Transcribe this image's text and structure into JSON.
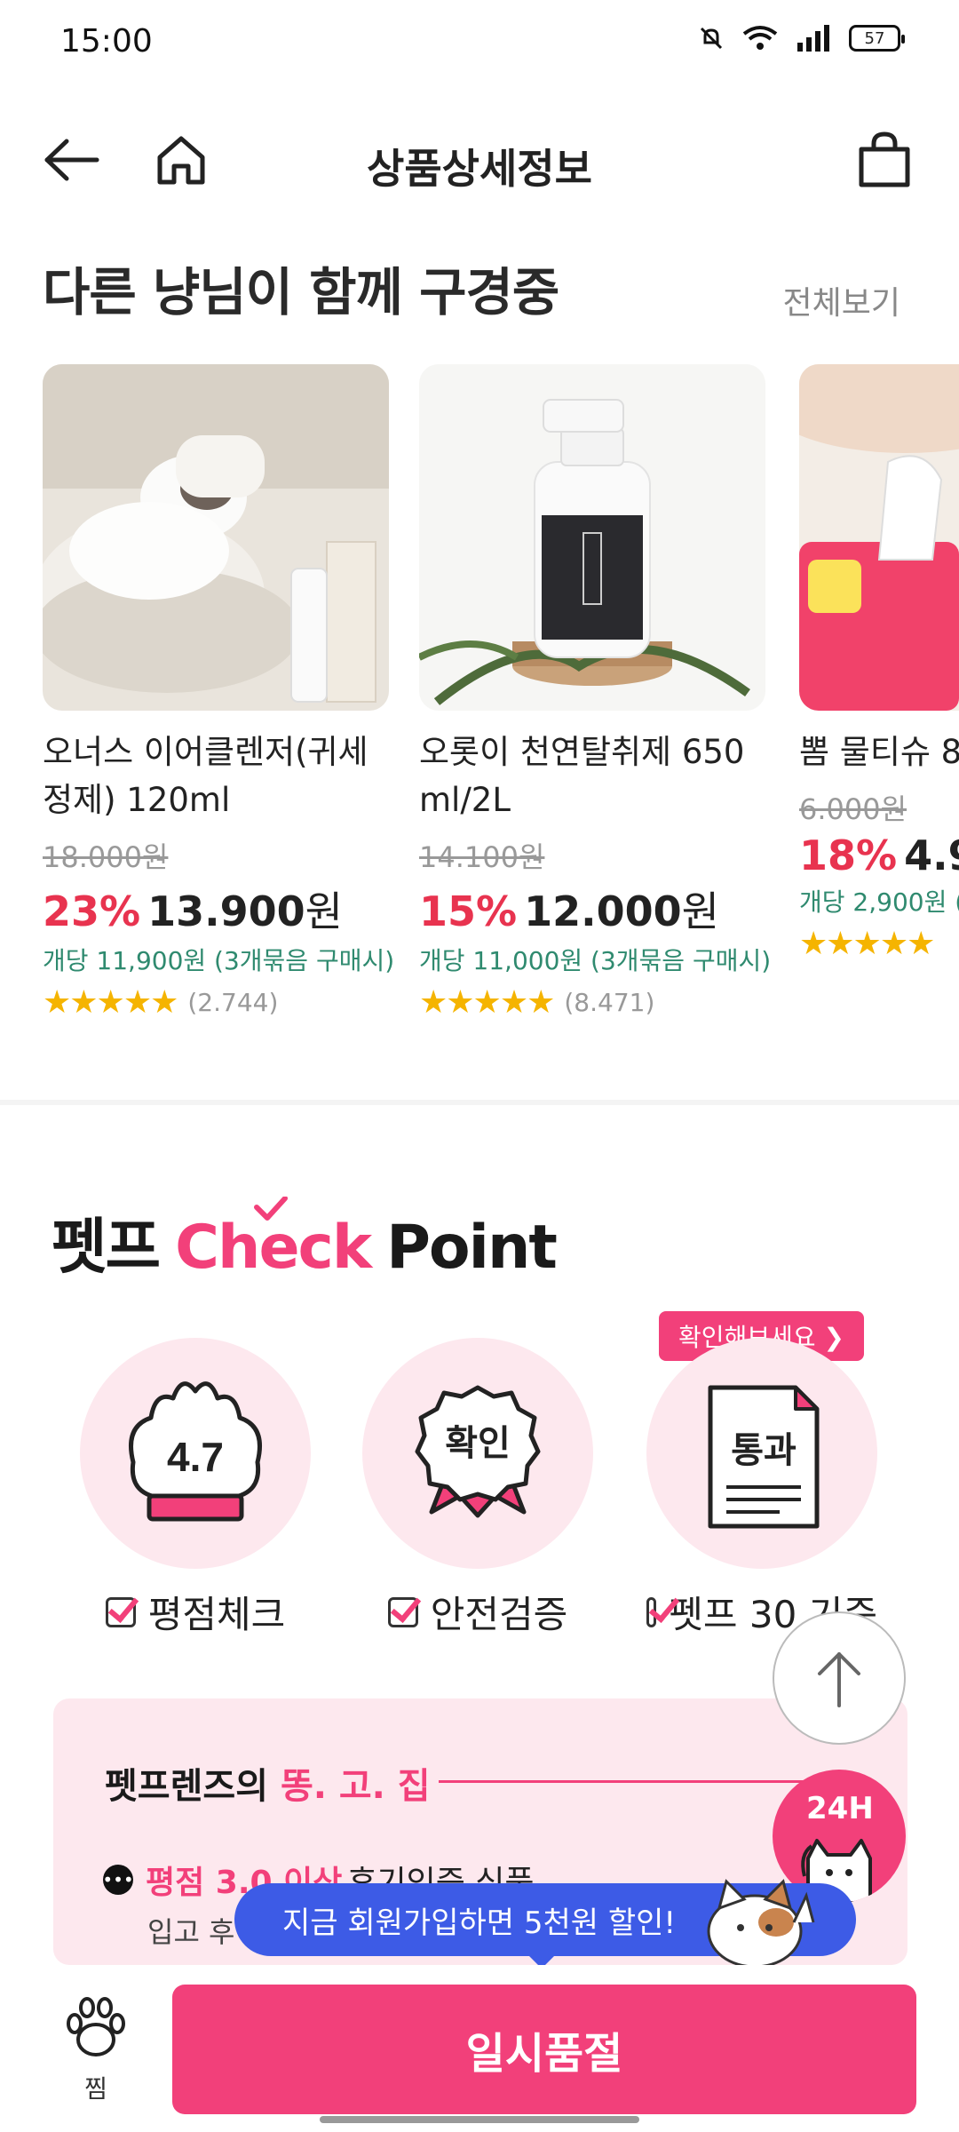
{
  "status_bar": {
    "time": "15:00",
    "battery": "57"
  },
  "header": {
    "title": "상품상세정보"
  },
  "similar": {
    "title": "다른 냥님이 함께 구경중",
    "see_all": "전체보기",
    "products": [
      {
        "name": "오너스 이어클렌저(귀세정제) 120ml",
        "original_price": "18.000원",
        "discount": "23%",
        "price": "13.900",
        "won": "원",
        "unit_price": "개당 11,900원 (3개묶음 구매시)",
        "stars": "★★★★★",
        "reviews": "(2.744)"
      },
      {
        "name": "오롯이 천연탈취제 650ml/2L",
        "original_price": "14.100원",
        "discount": "15%",
        "price": "12.000",
        "won": "원",
        "unit_price": "개당 11,000원 (3개묶음 구매시)",
        "stars": "★★★★★",
        "reviews": "(8.471)"
      },
      {
        "name": "뽐 물티슈 8",
        "original_price": "6.000원",
        "discount": "18%",
        "price": "4.9",
        "won": "",
        "unit_price": "개당 2,900원 (",
        "stars": "★★★★★",
        "reviews": ""
      }
    ]
  },
  "checkpoint": {
    "title_prefix": "펫프",
    "title_check": "Check",
    "title_point": "Point",
    "confirm_tag": "확인해보세요 ❯",
    "items": [
      {
        "badge": "4.7",
        "label": "평점체크"
      },
      {
        "badge": "확인",
        "label": "안전검증"
      },
      {
        "badge": "통과",
        "label": "펫프 30 기준"
      }
    ]
  },
  "ttogojip": {
    "title_prefix": "펫프렌즈의 ",
    "title_highlight": "똥. 고. 집",
    "row_highlight": "평점 3.0 이상",
    "row_text": "후기인증 식품",
    "sub_text": "입고 후"
  },
  "floating": {
    "cs_label": "24H",
    "signup_banner": "지금 회원가입하면 5천원 할인!"
  },
  "bottom": {
    "zzim_label": "찜",
    "soldout": "일시품절"
  },
  "icons": [
    "back-arrow-icon",
    "home-icon",
    "cart-icon",
    "paw-icon",
    "arrow-up-icon",
    "mute-icon",
    "wifi-icon",
    "signal-icon"
  ],
  "colors": {
    "accent": "#f2407a",
    "discount": "#e8334f",
    "unit_price": "#2f8a6f",
    "banner": "#3d5be6",
    "stars": "#f5b400"
  }
}
